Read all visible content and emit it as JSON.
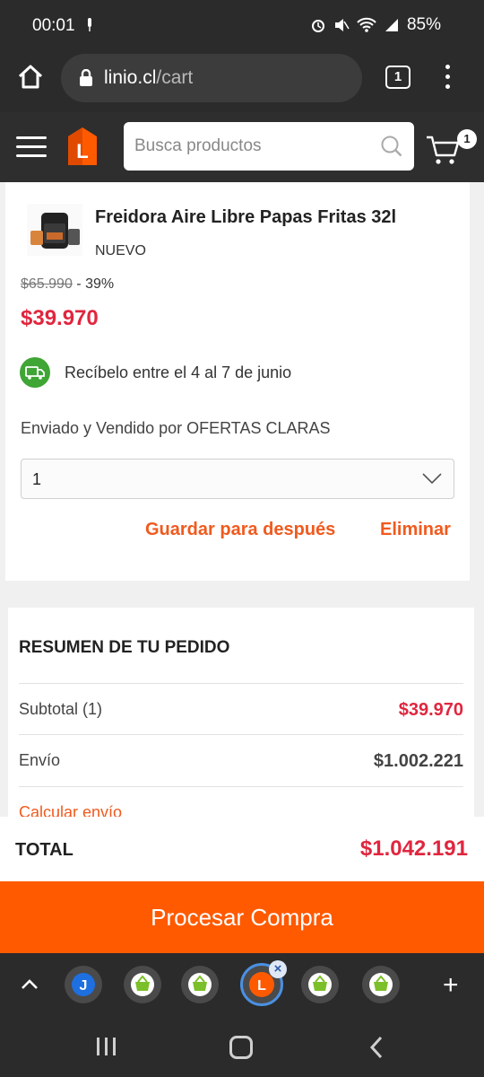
{
  "status_bar": {
    "time": "00:01",
    "battery": "85%"
  },
  "browser": {
    "url_host": "linio.cl",
    "url_path": "/cart",
    "tab_count": "1"
  },
  "header": {
    "search_placeholder": "Busca productos",
    "cart_count": "1",
    "logo_letter": "L"
  },
  "product": {
    "title": "Freidora Aire Libre Papas Fritas 32l",
    "condition": "NUEVO",
    "old_price": "$65.990",
    "discount": "- 39%",
    "price": "$39.970",
    "delivery": "Recíbelo entre el 4 al 7 de junio",
    "seller": "Enviado y Vendido por OFERTAS CLARAS",
    "quantity": "1",
    "save_later": "Guardar para después",
    "remove": "Eliminar"
  },
  "summary": {
    "title": "RESUMEN DE TU PEDIDO",
    "subtotal_label": "Subtotal (1)",
    "subtotal_value": "$39.970",
    "shipping_label": "Envío",
    "shipping_value": "$1.002.221",
    "calc_link": "Calcular envío",
    "total_label": "TOTAL",
    "total_value": "$1.042.191"
  },
  "checkout": {
    "label": "Procesar Compra"
  },
  "tab_strip": {
    "tabs": [
      {
        "icon": "j-icon",
        "letter": "J"
      },
      {
        "icon": "basket-icon"
      },
      {
        "icon": "basket-icon"
      },
      {
        "icon": "linio-icon",
        "letter": "L",
        "active": true
      },
      {
        "icon": "basket-icon"
      },
      {
        "icon": "basket-icon"
      }
    ],
    "close_symbol": "×",
    "add_symbol": "+"
  },
  "colors": {
    "brand": "#ff5a00",
    "price": "#e0263e",
    "link": "#f05a1e",
    "dark": "#2b2b2b"
  }
}
